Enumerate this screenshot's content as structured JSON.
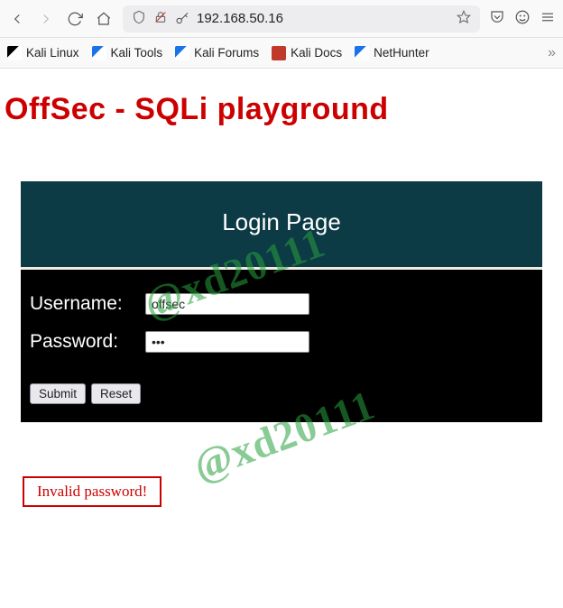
{
  "browser": {
    "url": "192.168.50.16"
  },
  "bookmarks": {
    "items": [
      {
        "label": "Kali Linux"
      },
      {
        "label": "Kali Tools"
      },
      {
        "label": "Kali Forums"
      },
      {
        "label": "Kali Docs"
      },
      {
        "label": "NetHunter"
      }
    ]
  },
  "page": {
    "title": "OffSec - SQLi playground",
    "login_header": "Login Page",
    "username_label": "Username:",
    "username_value": "offsec",
    "password_label": "Password:",
    "password_value": "•••",
    "submit_label": "Submit",
    "reset_label": "Reset",
    "error_message": "Invalid password!"
  },
  "watermark": "@xd20111"
}
